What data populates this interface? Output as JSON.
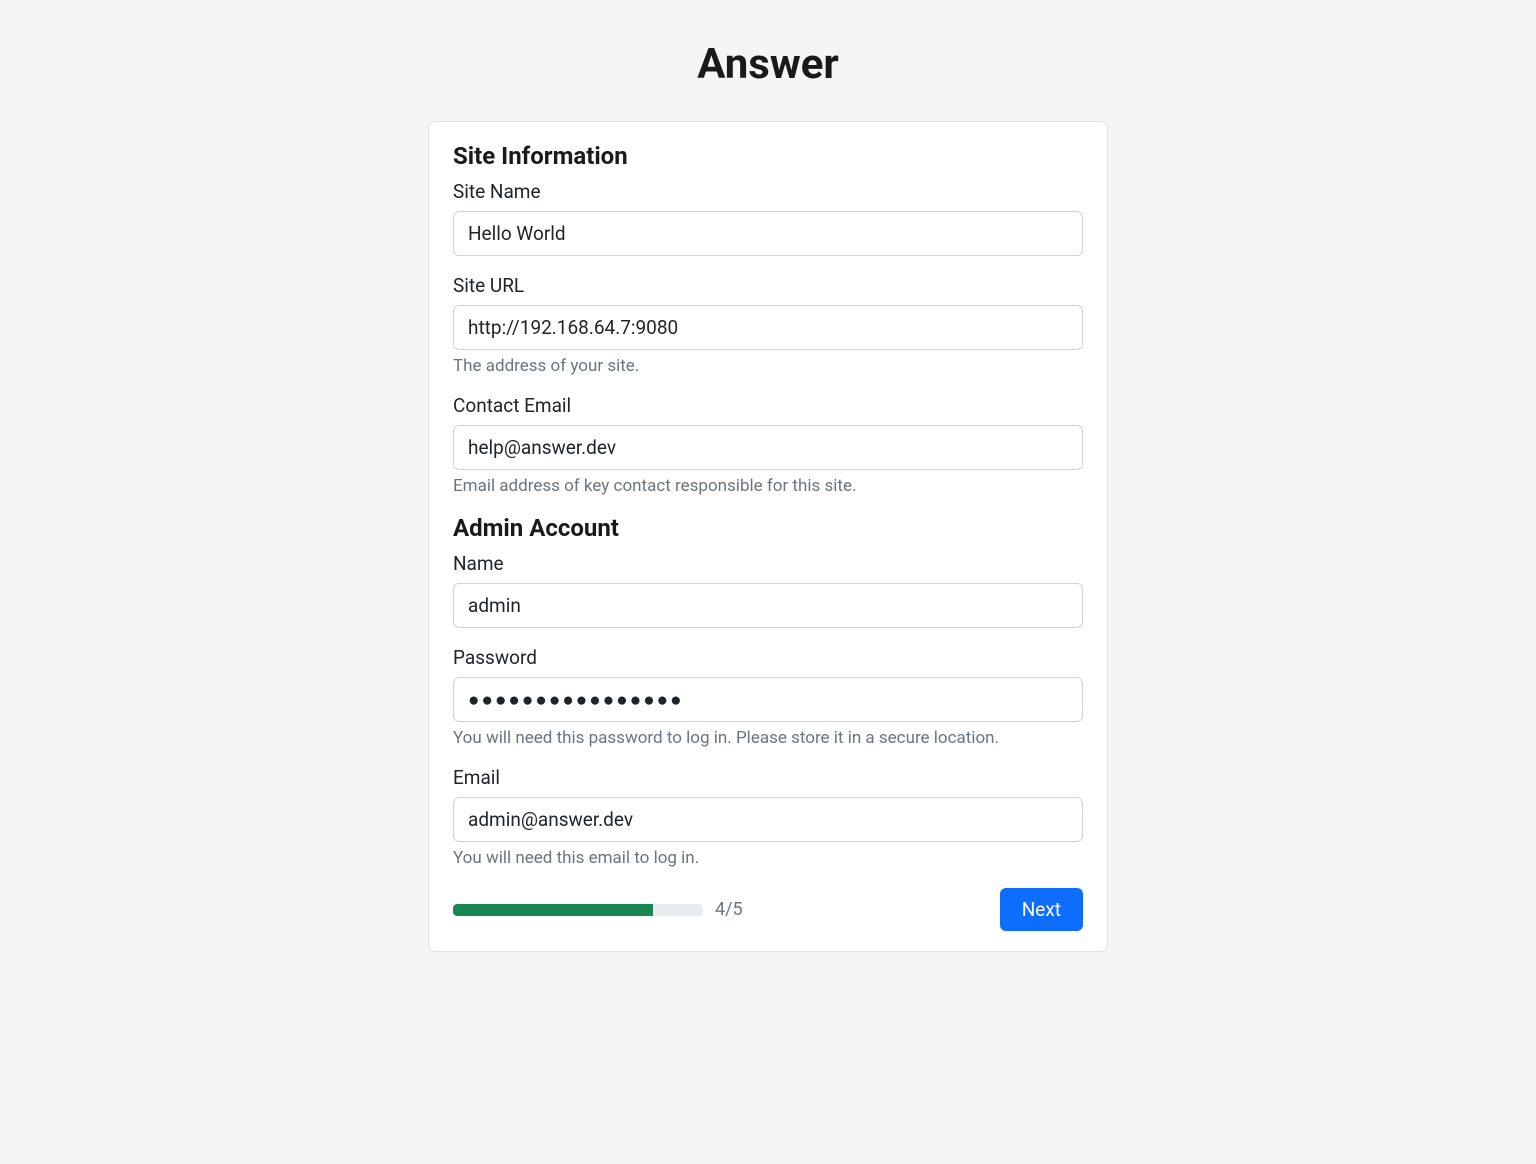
{
  "header": {
    "title": "Answer"
  },
  "siteInfo": {
    "sectionTitle": "Site Information",
    "siteName": {
      "label": "Site Name",
      "value": "Hello World"
    },
    "siteUrl": {
      "label": "Site URL",
      "value": "http://192.168.64.7:9080",
      "help": "The address of your site."
    },
    "contactEmail": {
      "label": "Contact Email",
      "value": "help@answer.dev",
      "help": "Email address of key contact responsible for this site."
    }
  },
  "adminAccount": {
    "sectionTitle": "Admin Account",
    "name": {
      "label": "Name",
      "value": "admin"
    },
    "password": {
      "label": "Password",
      "value": "●●●●●●●●●●●●●●●●",
      "help": "You will need this password to log in. Please store it in a secure location."
    },
    "email": {
      "label": "Email",
      "value": "admin@answer.dev",
      "help": "You will need this email to log in."
    }
  },
  "footer": {
    "progress": {
      "text": "4/5",
      "percent": 80
    },
    "nextButton": "Next"
  }
}
